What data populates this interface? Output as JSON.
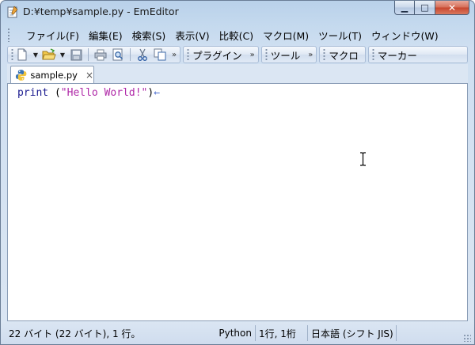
{
  "window": {
    "title": "D:¥temp¥sample.py - EmEditor",
    "controls": {
      "minimize": "▁",
      "maximize": "□",
      "close": "✕"
    }
  },
  "menu": {
    "items": [
      {
        "label": "ファイル(F)"
      },
      {
        "label": "編集(E)"
      },
      {
        "label": "検索(S)"
      },
      {
        "label": "表示(V)"
      },
      {
        "label": "比較(C)"
      },
      {
        "label": "マクロ(M)"
      },
      {
        "label": "ツール(T)"
      },
      {
        "label": "ウィンドウ(W)"
      }
    ]
  },
  "toolbar": {
    "chevron": "»",
    "plugin_label": "プラグイン",
    "tools_label": "ツール",
    "macro_label": "マクロ",
    "marker_label": "マーカー",
    "icons": [
      "new-file-icon",
      "open-folder-icon",
      "save-icon",
      "print-icon",
      "print-preview-icon",
      "cut-icon",
      "copy-icon"
    ]
  },
  "tabs": [
    {
      "label": "sample.py",
      "close": "×"
    }
  ],
  "editor": {
    "line1": {
      "keyword": "print",
      "space": " ",
      "open_paren": "(",
      "string": "\"Hello World!\"",
      "close_paren": ")",
      "eol_mark": "←"
    }
  },
  "statusbar": {
    "info": "22 バイト (22 バイト), 1 行。",
    "language": "Python",
    "position": "1行, 1桁",
    "encoding": "日本語 (シフト JIS)"
  },
  "colors": {
    "frame": "#b9d1ea",
    "keyword": "#1a1a8f",
    "string": "#b02aa8",
    "eol_mark": "#4d6fd0",
    "close_button": "#c7452d"
  }
}
